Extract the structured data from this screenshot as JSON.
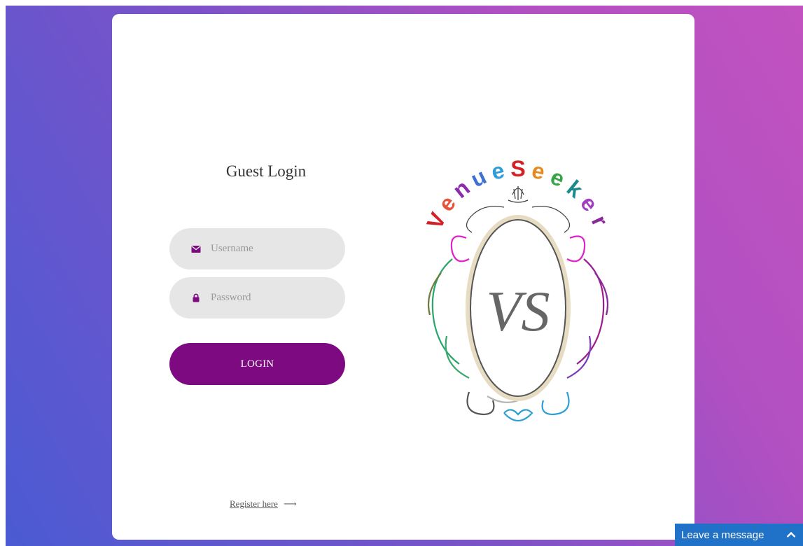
{
  "login": {
    "title": "Guest Login",
    "username_placeholder": "Username",
    "password_placeholder": "Password",
    "button_label": "LOGIN",
    "register_link": "Register here",
    "register_arrow": "⟶"
  },
  "logo": {
    "brand_text": "Venue Seeker",
    "monogram": "VS",
    "letters": [
      "V",
      "e",
      "n",
      "u",
      "e",
      "S",
      "e",
      "e",
      "k",
      "e",
      "r"
    ],
    "letter_colors": [
      "#d42027",
      "#e5533a",
      "#8b2bb0",
      "#3f6fd2",
      "#2f9bd8",
      "#d42027",
      "#e68a1f",
      "#3aa34a",
      "#1a8a8a",
      "#a13ec1",
      "#8a2a9a"
    ]
  },
  "chat": {
    "label": "Leave a message",
    "toggle_icon": "chevron-up-icon"
  },
  "colors": {
    "accent": "#7d0a80",
    "chat_blue": "#1f72c7"
  }
}
